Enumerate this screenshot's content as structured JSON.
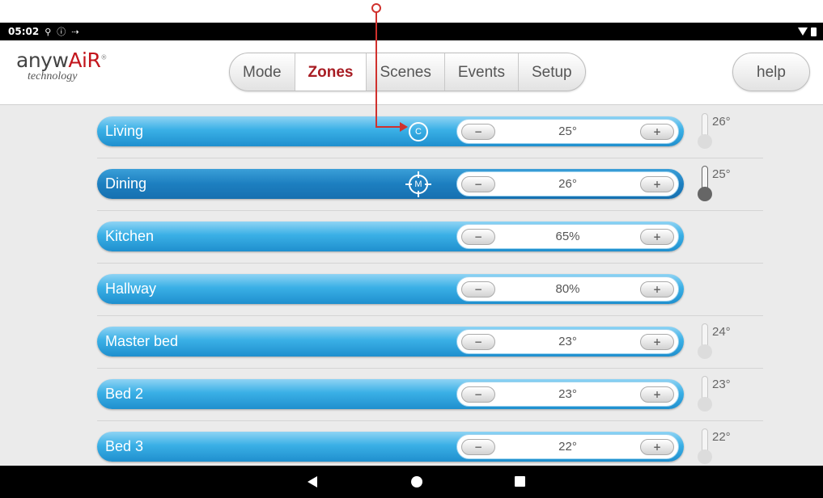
{
  "status_bar": {
    "time": "05:02",
    "icons": [
      "usb-icon",
      "info-icon",
      "signal-arrow-icon"
    ],
    "right_icons": [
      "wifi-icon",
      "battery-icon"
    ]
  },
  "logo": {
    "main_prefix": "anyw",
    "main_red": "AiR",
    "trademark": "®",
    "sub": "technology"
  },
  "nav": {
    "tabs": [
      {
        "label": "Mode",
        "active": false
      },
      {
        "label": "Zones",
        "active": true
      },
      {
        "label": "Scenes",
        "active": false
      },
      {
        "label": "Events",
        "active": false
      },
      {
        "label": "Setup",
        "active": false
      }
    ],
    "help_label": "help"
  },
  "zones": [
    {
      "name": "Living",
      "value": "25°",
      "mode_icon": "C",
      "temp": "26°"
    },
    {
      "name": "Dining",
      "value": "26°",
      "mode_icon": "M",
      "temp": "25°"
    },
    {
      "name": "Kitchen",
      "value": "65%",
      "mode_icon": "",
      "temp": ""
    },
    {
      "name": "Hallway",
      "value": "80%",
      "mode_icon": "",
      "temp": ""
    },
    {
      "name": "Master bed",
      "value": "23°",
      "mode_icon": "",
      "temp": "24°"
    },
    {
      "name": "Bed 2",
      "value": "23°",
      "mode_icon": "",
      "temp": "23°"
    },
    {
      "name": "Bed 3",
      "value": "22°",
      "mode_icon": "",
      "temp": "22°"
    }
  ],
  "controls": {
    "minus": "−",
    "plus": "+"
  },
  "colors": {
    "accent_red": "#c3151c",
    "zone_blue": "#1f8fce",
    "annotation_red": "#d0312d"
  }
}
